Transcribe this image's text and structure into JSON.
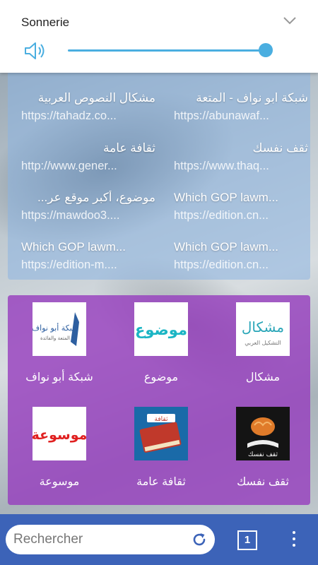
{
  "sound": {
    "title": "Sonnerie",
    "volume_level": 0.95,
    "accent": "#4aaee0"
  },
  "bookmarks": [
    {
      "title": "شبكة ابو نواف - المتعة",
      "url": "https://abunawaf...",
      "rtl": true
    },
    {
      "title": "مشكال النصوص العربية",
      "url": "https://tahadz.co...",
      "rtl": true
    },
    {
      "title": "ثقف نفسك",
      "url": "https://www.thaq...",
      "rtl": true
    },
    {
      "title": "ثقافة عامة",
      "url": "http://www.gener...",
      "rtl": true
    },
    {
      "title": "Which GOP lawm...",
      "url": "https://edition.cn...",
      "rtl": false
    },
    {
      "title": "موضوع، أكبر موقع عر...",
      "url": "https://mawdoo3....",
      "rtl": true
    },
    {
      "title": "Which GOP lawm...",
      "url": "https://edition.cn...",
      "rtl": false
    },
    {
      "title": "Which GOP lawm...",
      "url": "https://edition-m....",
      "rtl": false
    }
  ],
  "apps": [
    {
      "label": "مشكال",
      "icon": "mishkal-logo"
    },
    {
      "label": "موضوع",
      "icon": "mawdoo-logo"
    },
    {
      "label": "شبكة أبو نواف",
      "icon": "abunawaf-logo"
    },
    {
      "label": "ثقف نفسك",
      "icon": "brain-book-logo"
    },
    {
      "label": "ثقافة عامة",
      "icon": "book-logo"
    },
    {
      "label": "موسوعة",
      "icon": "mawsoua-logo"
    }
  ],
  "logos": {
    "mishkal": "مشكال",
    "mishkal_sub": "التشكيل العربي",
    "mawdoo": "موضوع",
    "abunawaf": "شبكة أبو نواف",
    "abunawaf_sub": "المتعة والفائدة",
    "brain": "ثقف نفسك",
    "book": "ثقافة",
    "mawsoua": "موسوعة"
  },
  "bottom": {
    "search_placeholder": "Rechercher",
    "tab_count": "1"
  },
  "colors": {
    "bookmarks_bg": "#8cb4e1",
    "apps_bg": "#963cbe",
    "bottom_bar": "#3c63b8"
  }
}
